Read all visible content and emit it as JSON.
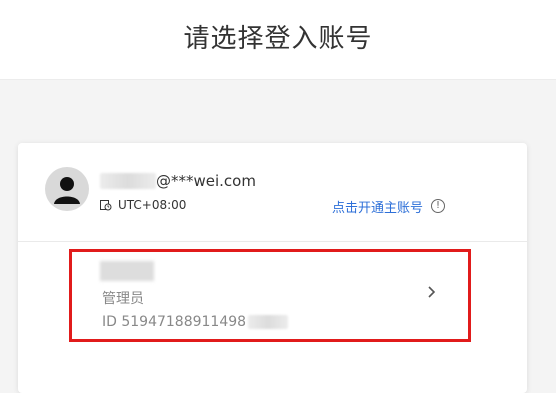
{
  "header": {
    "title": "请选择登入账号"
  },
  "account": {
    "email_suffix": "@***wei.com",
    "timezone": "UTC+08:00",
    "open_main_label": "点击开通主账号",
    "info_symbol": "!"
  },
  "sub_account": {
    "role": "管理员",
    "id_text": "ID 51947188911498"
  },
  "icons": {
    "avatar": "user-silhouette-icon",
    "timezone": "clock-calendar-icon",
    "info": "info-circle-icon",
    "chevron": "chevron-right-icon"
  },
  "colors": {
    "link": "#2d6fd8",
    "highlight_border": "#e11b1b",
    "background": "#f4f4f4"
  }
}
